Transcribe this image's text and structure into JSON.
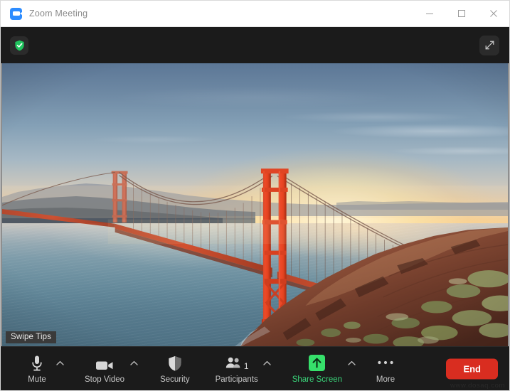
{
  "window": {
    "title": "Zoom Meeting",
    "app_icon": "zoom-video-icon",
    "controls": {
      "minimize": "minimize-icon",
      "maximize": "maximize-icon",
      "close": "close-icon"
    }
  },
  "topbar": {
    "security_shield": "green-shield-check-icon",
    "fullscreen": "expand-diagonal-icon"
  },
  "video": {
    "overlay_badge": "Swipe Tips",
    "scene": "golden-gate-bridge-sunset"
  },
  "toolbar": {
    "items": [
      {
        "label": "Mute",
        "icon": "microphone-icon",
        "has_chevron": true,
        "accent": "default"
      },
      {
        "label": "Stop Video",
        "icon": "video-camera-icon",
        "has_chevron": true,
        "accent": "default"
      },
      {
        "label": "Security",
        "icon": "shield-icon",
        "has_chevron": false,
        "accent": "default"
      },
      {
        "label": "Participants",
        "icon": "people-icon",
        "has_chevron": true,
        "accent": "default",
        "count": "1"
      },
      {
        "label": "Share Screen",
        "icon": "share-up-arrow-icon",
        "has_chevron": true,
        "accent": "green"
      },
      {
        "label": "More",
        "icon": "ellipsis-icon",
        "has_chevron": false,
        "accent": "default"
      }
    ],
    "end_button": "End",
    "watermark": "www.dosaq.com"
  },
  "colors": {
    "accent_green": "#3ad57a",
    "end_red": "#d92d20",
    "zoom_blue": "#2d8cff",
    "toolbar_bg": "#1b1b1b",
    "titlebar_bg": "#ffffff"
  }
}
